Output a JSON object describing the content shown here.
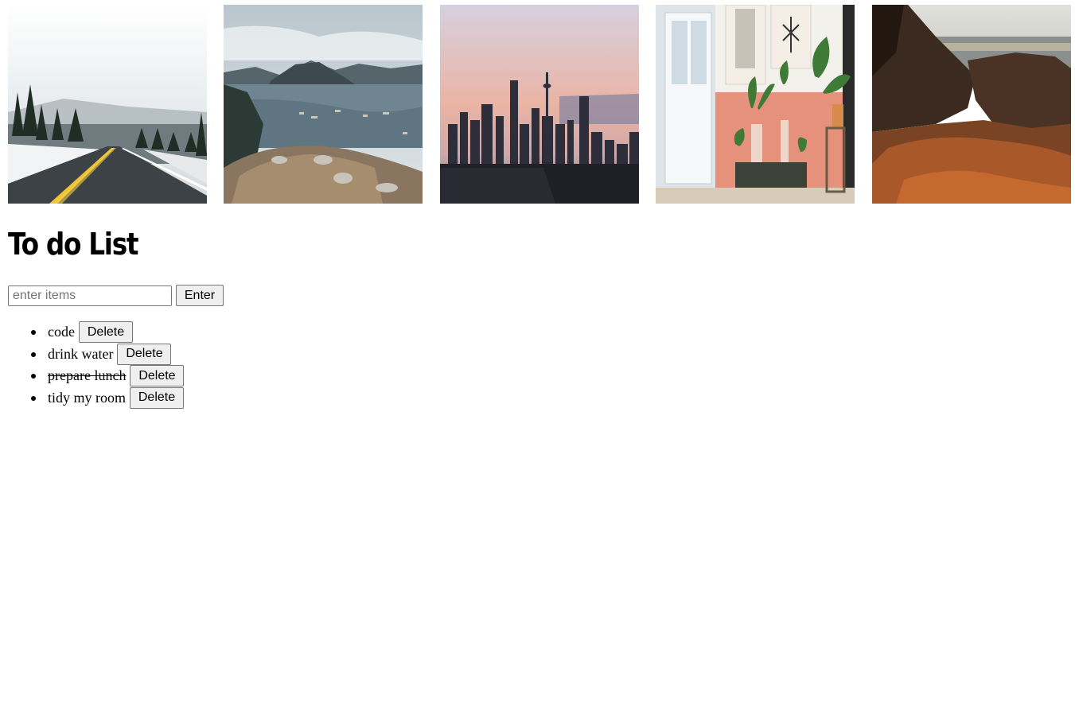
{
  "gallery": {
    "images": [
      {
        "name": "snowy-road-photo"
      },
      {
        "name": "fjord-mountain-photo"
      },
      {
        "name": "city-skyline-photo"
      },
      {
        "name": "plants-interior-photo"
      },
      {
        "name": "coastal-rocks-photo"
      }
    ]
  },
  "header": {
    "title": "To do List"
  },
  "form": {
    "input_placeholder": "enter items",
    "input_value": "",
    "enter_label": "Enter"
  },
  "todos": [
    {
      "text": "code",
      "done": false,
      "delete_label": "Delete"
    },
    {
      "text": "drink water",
      "done": false,
      "delete_label": "Delete"
    },
    {
      "text": "prepare lunch",
      "done": true,
      "delete_label": "Delete"
    },
    {
      "text": "tidy my room",
      "done": false,
      "delete_label": "Delete"
    }
  ]
}
